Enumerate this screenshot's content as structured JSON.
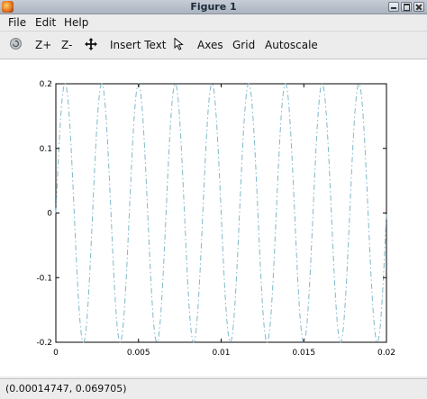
{
  "window": {
    "title": "Figure 1"
  },
  "menubar": {
    "file": "File",
    "edit": "Edit",
    "help": "Help"
  },
  "toolbar": {
    "rotate_icon": "rotate-icon",
    "zoom_in": "Z+",
    "zoom_out": "Z-",
    "pan_icon": "pan-icon",
    "insert_text": "Insert Text",
    "select_icon": "arrow-cursor-icon",
    "axes": "Axes",
    "grid": "Grid",
    "autoscale": "Autoscale"
  },
  "status": {
    "coordinates": "(0.00014747, 0.069705)"
  },
  "chart_data": {
    "type": "line",
    "title": "",
    "xlabel": "",
    "ylabel": "",
    "xlim": [
      0,
      0.02
    ],
    "ylim": [
      -0.2,
      0.2
    ],
    "xticks": [
      0,
      0.005,
      0.01,
      0.015,
      0.02
    ],
    "xtick_labels": [
      "0",
      "0.005",
      "0.01",
      "0.015",
      "0.02"
    ],
    "yticks": [
      -0.2,
      -0.1,
      0,
      0.1,
      0.2
    ],
    "ytick_labels": [
      "-0.2",
      "-0.1",
      "0",
      "0.1",
      "0.2"
    ],
    "grid": false,
    "series": [
      {
        "amplitude": 0.2,
        "frequency_hz": 450,
        "line_style": "dash-dot",
        "color": "#7fb8c8"
      }
    ]
  }
}
